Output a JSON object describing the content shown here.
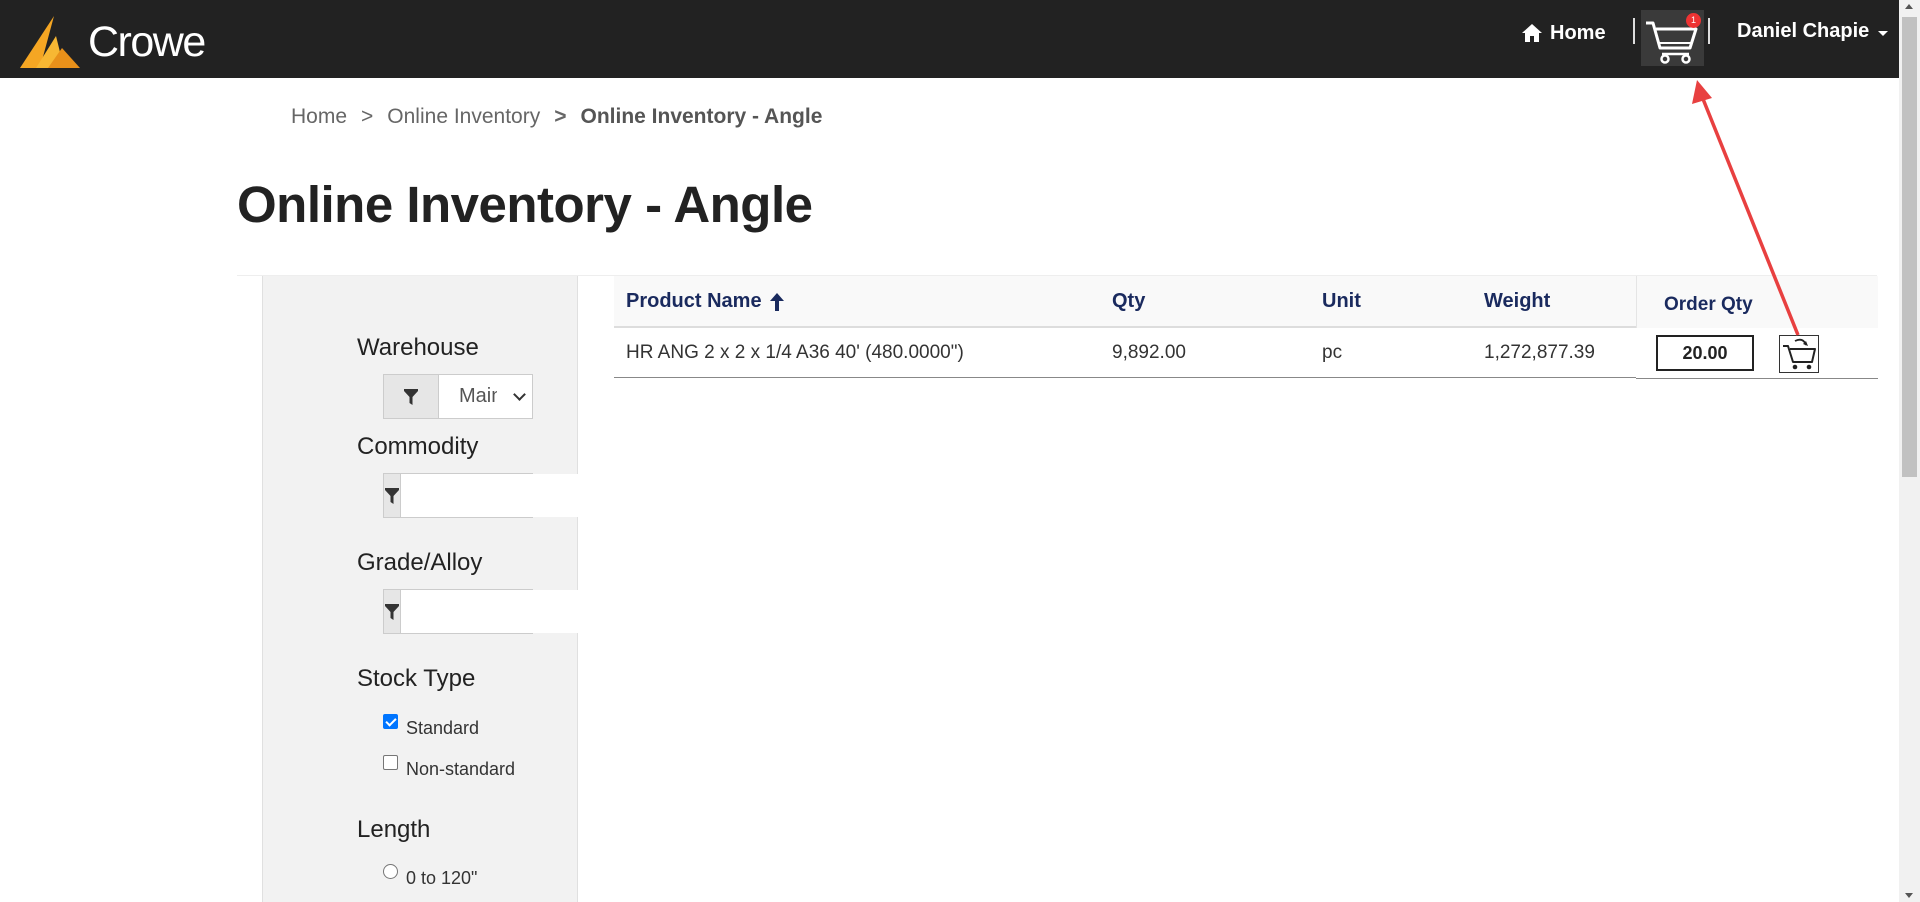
{
  "nav": {
    "brand": "Crowe",
    "home_label": "Home",
    "cart_count": "1",
    "user_name": "Daniel Chapie"
  },
  "breadcrumb": {
    "items": [
      "Home",
      "Online Inventory",
      "Online Inventory - Angle"
    ],
    "separator": ">"
  },
  "page": {
    "title": "Online Inventory - Angle"
  },
  "filters": {
    "warehouse": {
      "label": "Warehouse",
      "selected": "Main"
    },
    "commodity": {
      "label": "Commodity",
      "value": ""
    },
    "grade_alloy": {
      "label": "Grade/Alloy",
      "value": ""
    },
    "stock_type": {
      "label": "Stock Type",
      "options": [
        {
          "label": "Standard",
          "checked": true
        },
        {
          "label": "Non-standard",
          "checked": false
        }
      ]
    },
    "length": {
      "label": "Length",
      "options": [
        {
          "label": "0 to 120\"",
          "selected": false
        }
      ]
    }
  },
  "table": {
    "columns": {
      "product_name": "Product Name",
      "qty": "Qty",
      "unit": "Unit",
      "weight": "Weight",
      "order_qty": "Order Qty"
    },
    "rows": [
      {
        "product_name": "HR ANG 2 x 2 x 1/4 A36 40' (480.0000\")",
        "qty": "9,892.00",
        "unit": "pc",
        "weight": "1,272,877.39",
        "order_qty": "20.00"
      }
    ]
  },
  "colors": {
    "topbar": "#222222",
    "header_text": "#1a2a5e",
    "logo_gold": "#f5a623",
    "annotation": "#e84040"
  }
}
